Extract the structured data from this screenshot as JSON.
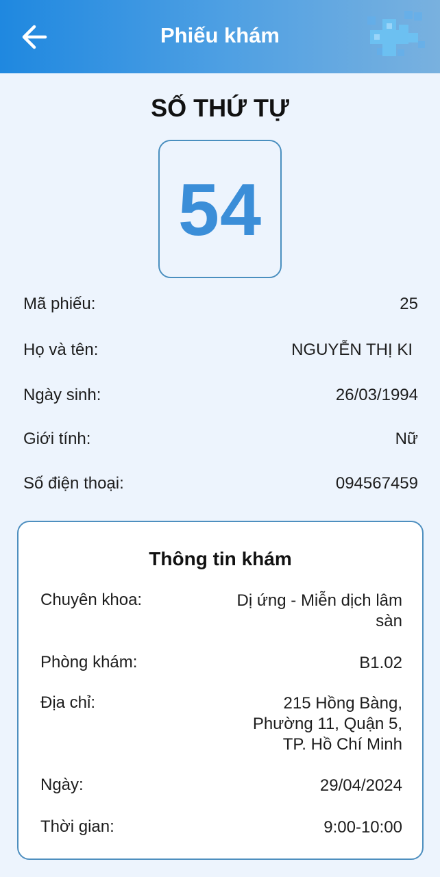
{
  "header": {
    "title": "Phiếu khám",
    "back_icon": "arrow-left-icon",
    "logo_icon": "medical-cross-logo",
    "gradient": [
      "#1f88e0",
      "#79b1df"
    ]
  },
  "queue": {
    "title": "SỐ THỨ TỰ",
    "number": "54",
    "number_color": "#3b8ed8"
  },
  "patient": {
    "ticket_label": "Mã phiếu:",
    "ticket_value": "25",
    "name_label": "Họ và tên:",
    "name_value": "NGUYỄN THỊ KI",
    "dob_label": "Ngày sinh:",
    "dob_value": "26/03/1994",
    "gender_label": "Giới tính:",
    "gender_value": "Nữ",
    "phone_label": "Số điện thoại:",
    "phone_value": "094567459"
  },
  "exam": {
    "title": "Thông tin khám",
    "specialty_label": "Chuyên khoa:",
    "specialty_line1": "Dị ứng - Miễn dịch lâm",
    "specialty_line2": "sàn",
    "room_label": "Phòng khám:",
    "room_value": "B1.02",
    "address_label": "Địa chỉ:",
    "address_line1": "215 Hồng Bàng,",
    "address_line2": "Phường 11, Quận 5,",
    "address_line3": "TP. Hồ Chí Minh",
    "date_label": "Ngày:",
    "date_value": "29/04/2024",
    "time_label": "Thời gian:",
    "time_value": "9:00-10:00"
  }
}
